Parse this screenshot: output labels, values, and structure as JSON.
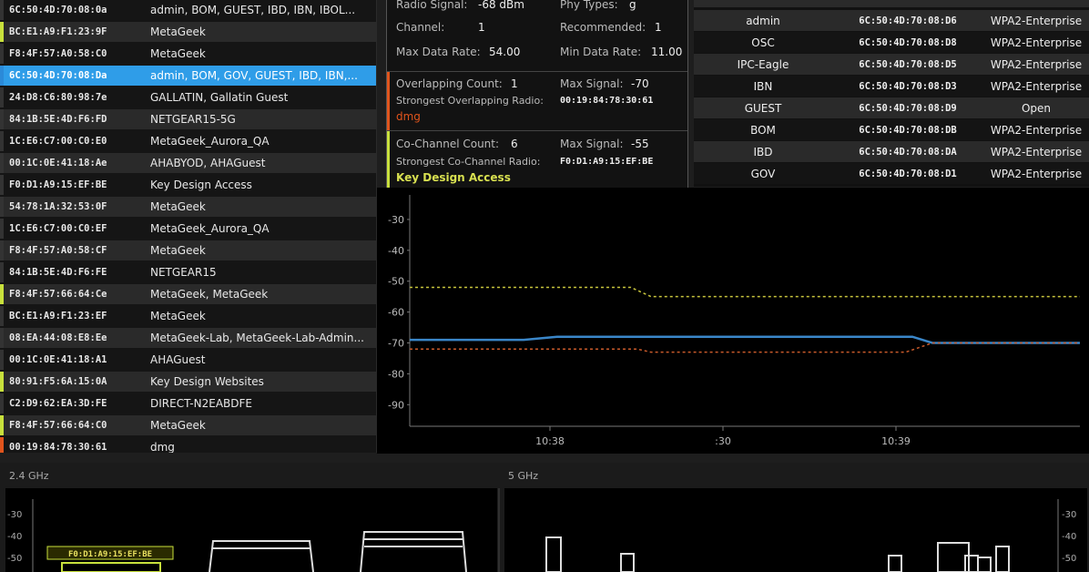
{
  "ap_list": [
    {
      "mac": "6C:50:4D:70:08:0a",
      "ssid": "admin, BOM, GUEST, IBD, IBN, IBOL...",
      "stripe": "#333",
      "bg": "#151515"
    },
    {
      "mac": "BC:E1:A9:F1:23:9F",
      "ssid": "MetaGeek",
      "stripe": "#c8e03c",
      "bg": "#2a2a2a"
    },
    {
      "mac": "F8:4F:57:A0:58:C0",
      "ssid": "MetaGeek",
      "stripe": "#333",
      "bg": "#151515"
    },
    {
      "mac": "6C:50:4D:70:08:Da",
      "ssid": "admin, BOM, GOV, GUEST, IBD, IBN,...",
      "stripe": "#2b8ad8",
      "bg": "#2f9de8",
      "selected": true
    },
    {
      "mac": "24:D8:C6:80:98:7e",
      "ssid": "GALLATIN, Gallatin Guest",
      "stripe": "#333",
      "bg": "#151515"
    },
    {
      "mac": "84:1B:5E:4D:F6:FD",
      "ssid": "NETGEAR15-5G",
      "stripe": "#333",
      "bg": "#2a2a2a"
    },
    {
      "mac": "1C:E6:C7:00:C0:E0",
      "ssid": "MetaGeek_Aurora_QA",
      "stripe": "#333",
      "bg": "#151515"
    },
    {
      "mac": "00:1C:0E:41:18:Ae",
      "ssid": "AHABYOD, AHAGuest",
      "stripe": "#333",
      "bg": "#2a2a2a"
    },
    {
      "mac": "F0:D1:A9:15:EF:BE",
      "ssid": "Key Design Access",
      "stripe": "#333",
      "bg": "#151515"
    },
    {
      "mac": "54:78:1A:32:53:0F",
      "ssid": "MetaGeek",
      "stripe": "#333",
      "bg": "#2a2a2a"
    },
    {
      "mac": "1C:E6:C7:00:C0:EF",
      "ssid": "MetaGeek_Aurora_QA",
      "stripe": "#333",
      "bg": "#151515"
    },
    {
      "mac": "F8:4F:57:A0:58:CF",
      "ssid": "MetaGeek",
      "stripe": "#333",
      "bg": "#2a2a2a"
    },
    {
      "mac": "84:1B:5E:4D:F6:FE",
      "ssid": "NETGEAR15",
      "stripe": "#333",
      "bg": "#151515"
    },
    {
      "mac": "F8:4F:57:66:64:Ce",
      "ssid": "MetaGeek, MetaGeek",
      "stripe": "#c8e03c",
      "bg": "#2a2a2a"
    },
    {
      "mac": "BC:E1:A9:F1:23:EF",
      "ssid": "MetaGeek",
      "stripe": "#333",
      "bg": "#151515"
    },
    {
      "mac": "08:EA:44:08:E8:Ee",
      "ssid": "MetaGeek-Lab, MetaGeek-Lab-Admin...",
      "stripe": "#333",
      "bg": "#2a2a2a"
    },
    {
      "mac": "00:1C:0E:41:18:A1",
      "ssid": "AHAGuest",
      "stripe": "#333",
      "bg": "#151515"
    },
    {
      "mac": "80:91:F5:6A:15:0A",
      "ssid": "Key Design Websites",
      "stripe": "#c8e03c",
      "bg": "#2a2a2a"
    },
    {
      "mac": "C2:D9:62:EA:3D:FE",
      "ssid": "DIRECT-N2EABDFE",
      "stripe": "#333",
      "bg": "#151515"
    },
    {
      "mac": "F8:4F:57:66:64:C0",
      "ssid": "MetaGeek",
      "stripe": "#c8e03c",
      "bg": "#2a2a2a"
    },
    {
      "mac": "00:19:84:78:30:61",
      "ssid": "dmg",
      "stripe": "#e0541c",
      "bg": "#151515"
    }
  ],
  "tooltip": {
    "radio_signal_label": "Radio Signal:",
    "radio_signal_value": "-68 dBm",
    "phy_types_label": "Phy Types:",
    "phy_types_value": "g",
    "channel_label": "Channel:",
    "channel_value": "1",
    "recommended_label": "Recommended:",
    "recommended_value": "1",
    "max_rate_label": "Max Data Rate:",
    "max_rate_value": "54.00",
    "min_rate_label": "Min Data Rate:",
    "min_rate_value": "11.00",
    "overlap_count_label": "Overlapping Count:",
    "overlap_count_value": "1",
    "overlap_max_label": "Max Signal:",
    "overlap_max_value": "-70",
    "overlap_strongest_label": "Strongest Overlapping Radio:",
    "overlap_strongest_mac": "00:19:84:78:30:61",
    "overlap_strongest_name": "dmg",
    "cochannel_count_label": "Co-Channel Count:",
    "cochannel_count_value": "6",
    "cochannel_max_label": "Max Signal:",
    "cochannel_max_value": "-55",
    "cochannel_strongest_label": "Strongest Co-Channel Radio:",
    "cochannel_strongest_mac": "F0:D1:A9:15:EF:BE",
    "cochannel_strongest_name": "Key Design Access",
    "colors": {
      "overlap": "#e0541c",
      "cochannel": "#c8e03c"
    }
  },
  "networks": [
    {
      "ssid": "admin",
      "mac": "6C:50:4D:70:08:D6",
      "security": "WPA2-Enterprise"
    },
    {
      "ssid": "OSC",
      "mac": "6C:50:4D:70:08:D8",
      "security": "WPA2-Enterprise"
    },
    {
      "ssid": "IPC-Eagle",
      "mac": "6C:50:4D:70:08:D5",
      "security": "WPA2-Enterprise"
    },
    {
      "ssid": "IBN",
      "mac": "6C:50:4D:70:08:D3",
      "security": "WPA2-Enterprise"
    },
    {
      "ssid": "GUEST",
      "mac": "6C:50:4D:70:08:D9",
      "security": "Open"
    },
    {
      "ssid": "BOM",
      "mac": "6C:50:4D:70:08:DB",
      "security": "WPA2-Enterprise"
    },
    {
      "ssid": "IBD",
      "mac": "6C:50:4D:70:08:DA",
      "security": "WPA2-Enterprise"
    },
    {
      "ssid": "GOV",
      "mac": "6C:50:4D:70:08:D1",
      "security": "WPA2-Enterprise"
    }
  ],
  "chart_data": {
    "type": "line",
    "y_ticks": [
      "-30",
      "-40",
      "-50",
      "-60",
      "-70",
      "-80",
      "-90"
    ],
    "ylim": [
      -97,
      -25
    ],
    "x_ticks": [
      "10:38",
      ":30",
      "10:39"
    ],
    "x_tick_positions": [
      0.0,
      0.5,
      1.0
    ],
    "series": [
      {
        "color": "#c8c43c",
        "dashed": true,
        "x": [
          0,
          0.33,
          0.36,
          1
        ],
        "values": [
          -52,
          -52,
          -55,
          -55
        ]
      },
      {
        "color": "#3a86c8",
        "dashed": false,
        "x": [
          0,
          0.17,
          0.22,
          0.75,
          0.78,
          1
        ],
        "values": [
          -69,
          -69,
          -68,
          -68,
          -70,
          -70
        ]
      },
      {
        "color": "#c85a2a",
        "dashed": true,
        "x": [
          0,
          0.34,
          0.36,
          0.74,
          0.78,
          1
        ],
        "values": [
          -72,
          -72,
          -73,
          -73,
          -70,
          -70
        ]
      }
    ]
  },
  "bottom": {
    "band_24": "2.4 GHz",
    "band_5": "5 GHz",
    "y_ticks": [
      "-30",
      "-40",
      "-50"
    ],
    "marker_mac": "F0:D1:A9:15:EF:BE"
  }
}
